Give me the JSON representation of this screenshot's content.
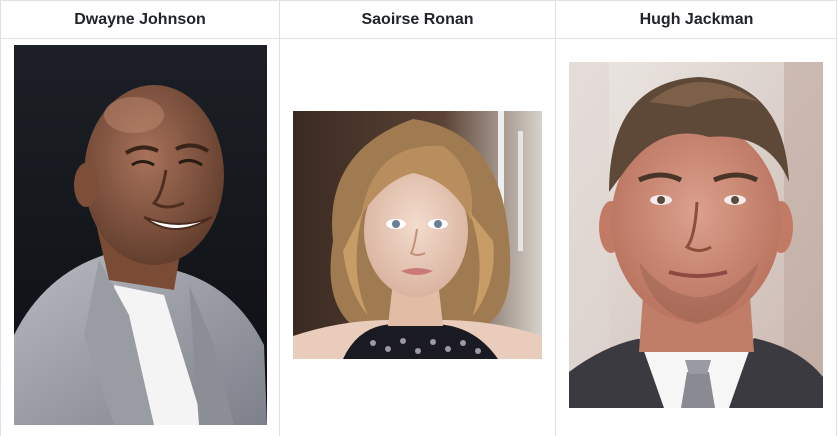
{
  "columns": [
    {
      "name": "Dwayne Johnson",
      "photo_icon": "portrait-dwayne-johnson"
    },
    {
      "name": "Saoirse Ronan",
      "photo_icon": "portrait-saoirse-ronan"
    },
    {
      "name": "Hugh Jackman",
      "photo_icon": "portrait-hugh-jackman"
    }
  ],
  "colors": {
    "border": "#dee2e6",
    "text": "#212529"
  }
}
